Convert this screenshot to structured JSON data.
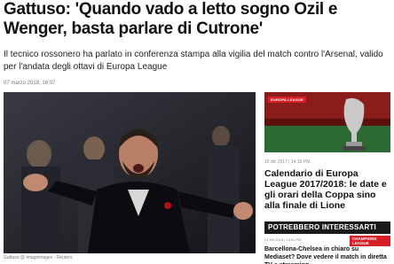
{
  "article": {
    "headline": "Gattuso: 'Quando vado a letto sogno Ozil e Wenger, basta parlare di Cutrone'",
    "intro": "Il tecnico rossonero ha parlato in conferenza stampa alla vigilia del match contro l'Arsenal, valido per l'andata degli ottavi di Europa League",
    "date": "07 marzo 2018, 16:07",
    "photo_caption": "Gattuso @ Imagoimages - Reuters"
  },
  "sidebar": {
    "related": {
      "tag": "EUROPA LEAGUE",
      "date": "15 dic 2017 | 14:10 PM",
      "title": "Calendario di Europa League 2017/2018: le date e gli orari della Coppa sino alla finale di Lione"
    },
    "recommended": {
      "heading": "POTREBBERO INTERESSARTI",
      "date": "21 feb 2018 | 13:51 PM",
      "tag": "CHAMPIONS LEAGUE",
      "title": "Barcellona-Chelsea in chiaro su Mediaset? Dove vedere il match in diretta TV e streaming"
    }
  },
  "colors": {
    "accent": "#d61f26",
    "dark_bar": "#1a1a1a"
  }
}
